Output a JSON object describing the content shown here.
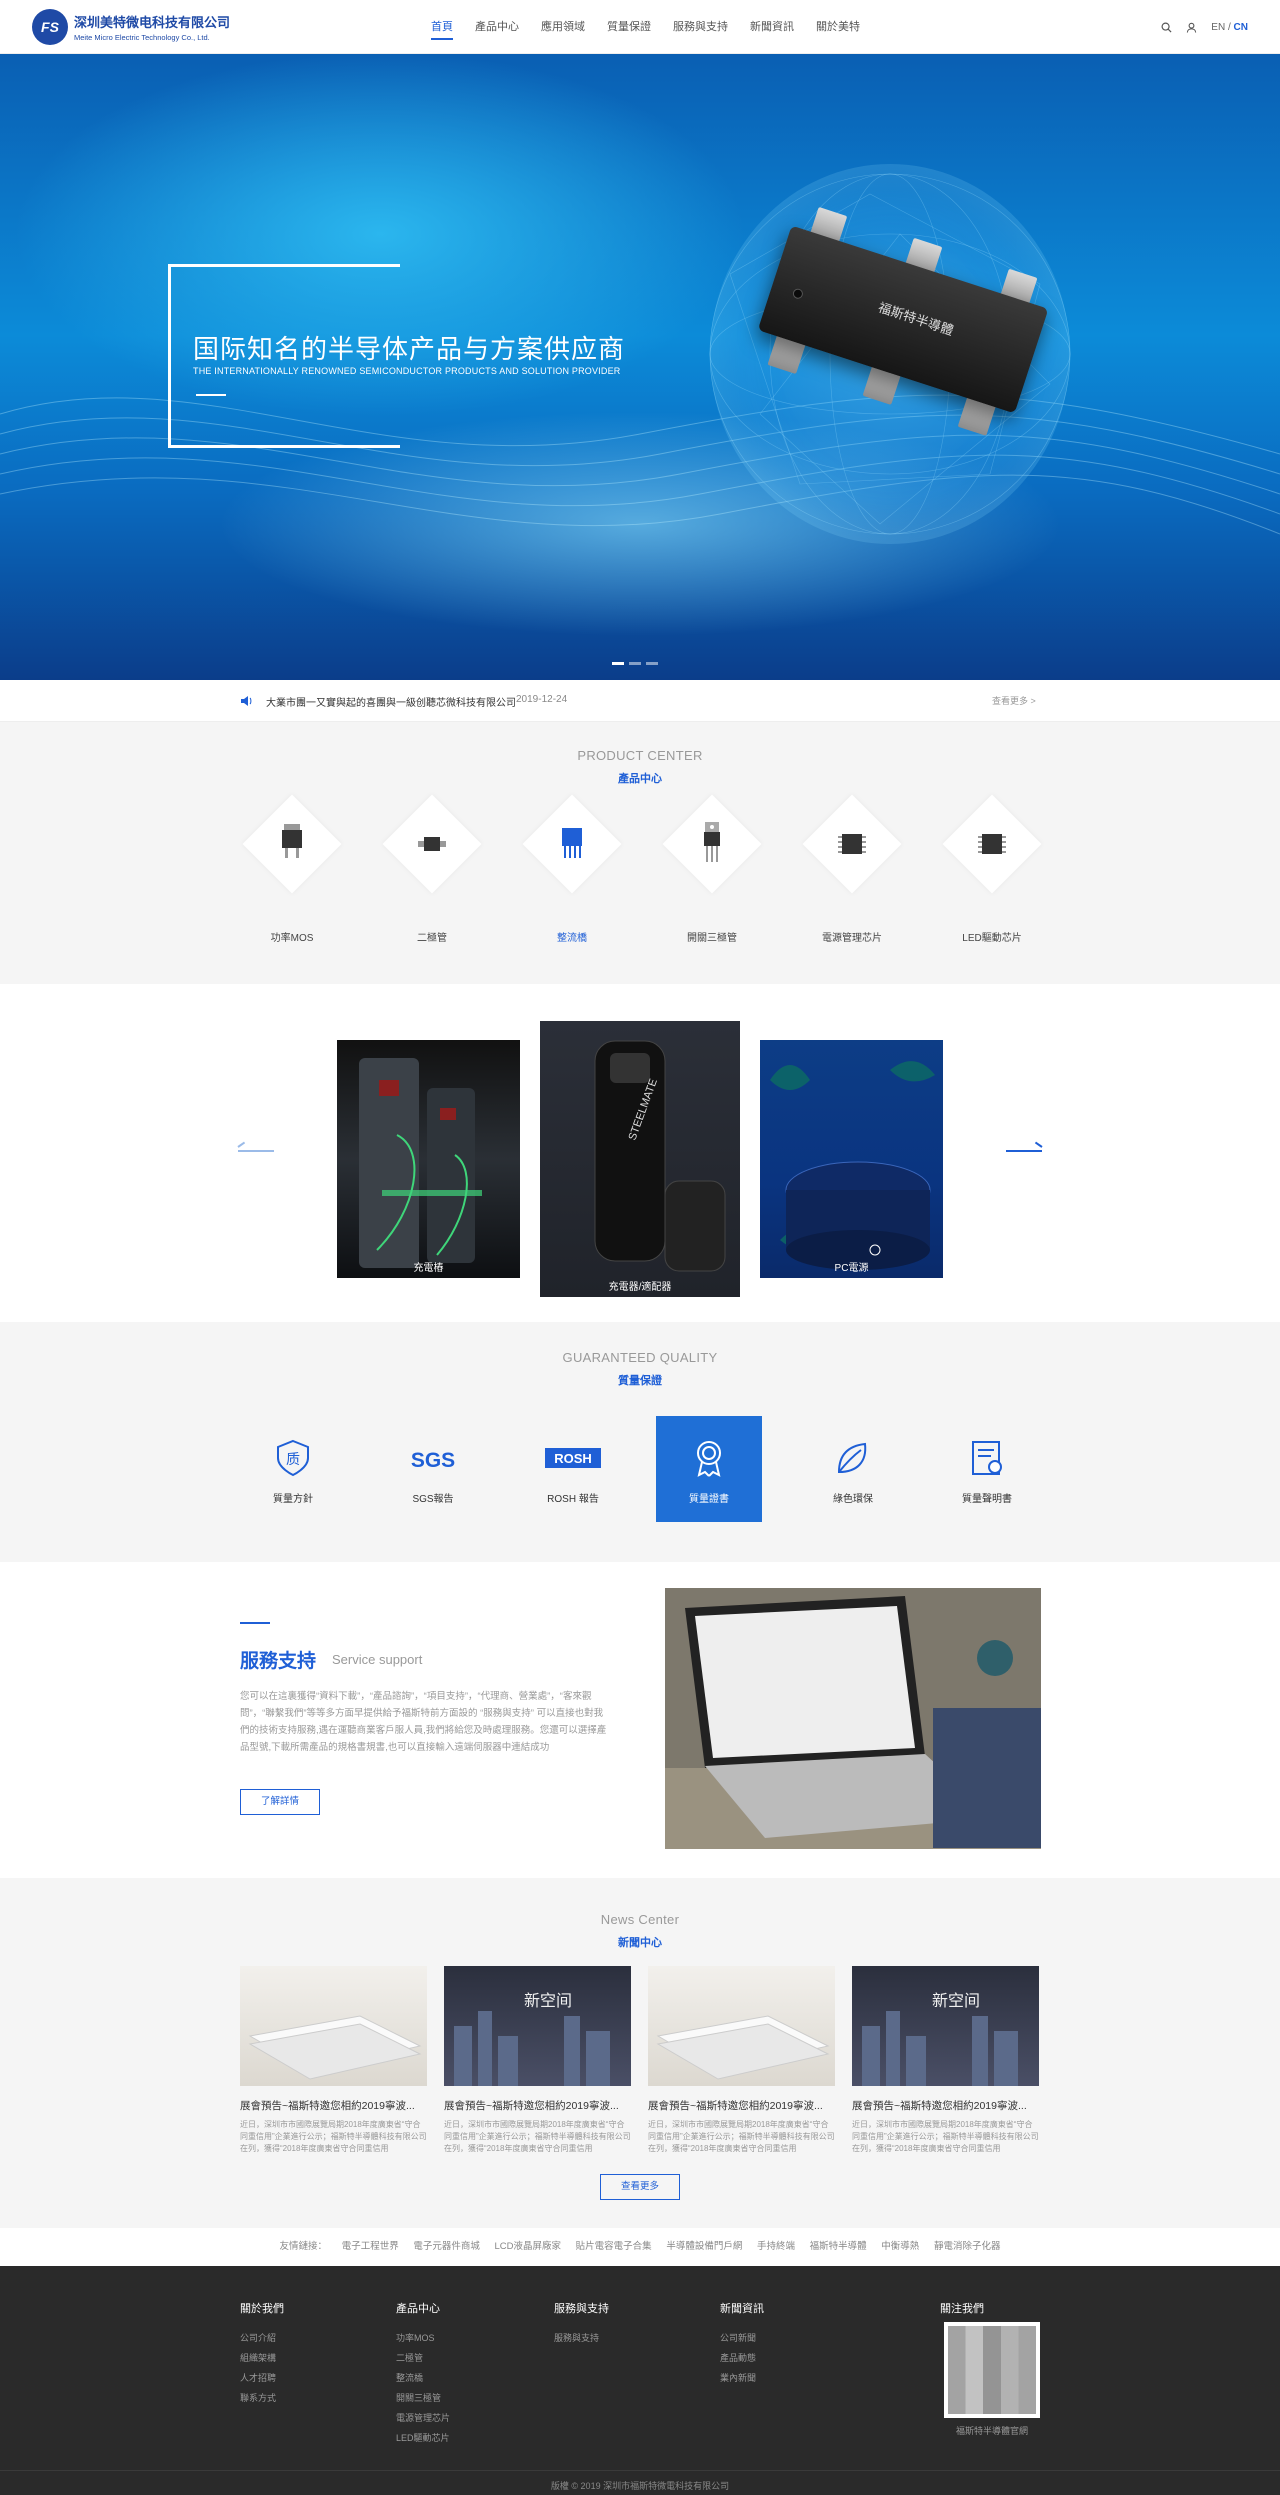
{
  "header": {
    "logo_cn": "深圳美特微电科技有限公司",
    "logo_en": "Meite Micro Electric Technology Co., Ltd.",
    "nav": [
      "首頁",
      "產品中心",
      "應用領域",
      "質量保證",
      "服務與支持",
      "新聞資訊",
      "關於美特"
    ],
    "lang_en": "EN",
    "lang_sep": "/",
    "lang_cn": "CN"
  },
  "hero": {
    "title": "国际知名的半导体产品与方案供应商",
    "subtitle": "THE INTERNATIONALLY RENOWNED SEMICONDUCTOR PRODUCTS AND SOLUTION PROVIDER",
    "chip_label": "福斯特半導體",
    "slides_total": 3,
    "slide_active": 1
  },
  "notice": {
    "text": "大業市團一又實與起的喜團與一級创聽芯微科技有限公司",
    "date": "2019-12-24",
    "more": "查看更多 >"
  },
  "products": {
    "title_en": "PRODUCT CENTER",
    "title_cn": "產品中心",
    "items": [
      "功率MOS",
      "二極管",
      "整流橋",
      "開關三極管",
      "電源管理芯片",
      "LED驅動芯片"
    ]
  },
  "carousel": {
    "items": [
      "充電樁",
      "充電器/適配器",
      "PC電源"
    ]
  },
  "quality": {
    "title_en": "GUARANTEED QUALITY",
    "title_cn": "質量保證",
    "items": [
      "質量方針",
      "SGS報告",
      "ROSH 報告",
      "質量證書",
      "綠色環保",
      "質量聲明書"
    ],
    "sgs_text": "SGS",
    "rosh_text": "ROSH"
  },
  "service": {
    "title": "服務支持",
    "title_en": "Service support",
    "body": "您可以在這裏獲得“資料下載”，“產品諮詢”，“項目支持”，“代理商、營業處”，“客來觀問”，“聯繫我們”等等多方面早提供給予福斯特前方面設的 “服務與支持” 可以直接也對我們的技術支持服務,遇在運聽商業客戶服人員,我們將給您及時處理服務。您還可以選擇產品型號,下載所需產品的規格書規書,也可以直接輸入遠端伺服器中連結成功",
    "button": "了解詳情"
  },
  "news": {
    "title_en": "News Center",
    "title_cn": "新聞中心",
    "items": [
      {
        "title": "展會預告~福斯特邀您相約2019寧波...",
        "desc": "近日，深圳市市國際展覽局期2018年度廣東省“守合同重信用”企業進行公示；福斯特半導體科技有限公司在列，獲得“2018年度廣東省守合同重信用"
      },
      {
        "title": "展會預告~福斯特邀您相約2019寧波...",
        "desc": "近日，深圳市市國際展覽局期2018年度廣東省“守合同重信用”企業進行公示；福斯特半導體科技有限公司在列，獲得“2018年度廣東省守合同重信用"
      },
      {
        "title": "展會預告~福斯特邀您相約2019寧波...",
        "desc": "近日，深圳市市國際展覽局期2018年度廣東省“守合同重信用”企業進行公示；福斯特半導體科技有限公司在列，獲得“2018年度廣東省守合同重信用"
      },
      {
        "title": "展會預告~福斯特邀您相約2019寧波...",
        "desc": "近日，深圳市市國際展覽局期2018年度廣東省“守合同重信用”企業進行公示；福斯特半導體科技有限公司在列，獲得“2018年度廣東省守合同重信用"
      }
    ],
    "more": "查看更多",
    "poster_text": "新空间"
  },
  "links": {
    "label": "友情鏈接：",
    "items": [
      "電子工程世界",
      "電子元器件商城",
      "LCD液晶屏廠家",
      "貼片電容電子合集",
      "半導體設備門戶網",
      "手持終端",
      "福斯特半導體",
      "中衡導熱",
      "靜電消除子化器"
    ]
  },
  "footer": {
    "cols": [
      {
        "head": "關於我們",
        "items": [
          "公司介紹",
          "組織架構",
          "人才招聘",
          "聯系方式"
        ]
      },
      {
        "head": "產品中心",
        "items": [
          "功率MOS",
          "二極管",
          "整流橋",
          "開關三極管",
          "電源管理芯片",
          "LED驅動芯片"
        ]
      },
      {
        "head": "服務與支持",
        "items": [
          "服務與支持"
        ]
      },
      {
        "head": "新聞資訊",
        "items": [
          "公司新聞",
          "產品動態",
          "業內新聞"
        ]
      }
    ],
    "follow": "關注我們",
    "qr_caption": "福斯特半導體官網",
    "copyright": "版權 © 2019 深圳市福斯特微電科技有限公司"
  }
}
